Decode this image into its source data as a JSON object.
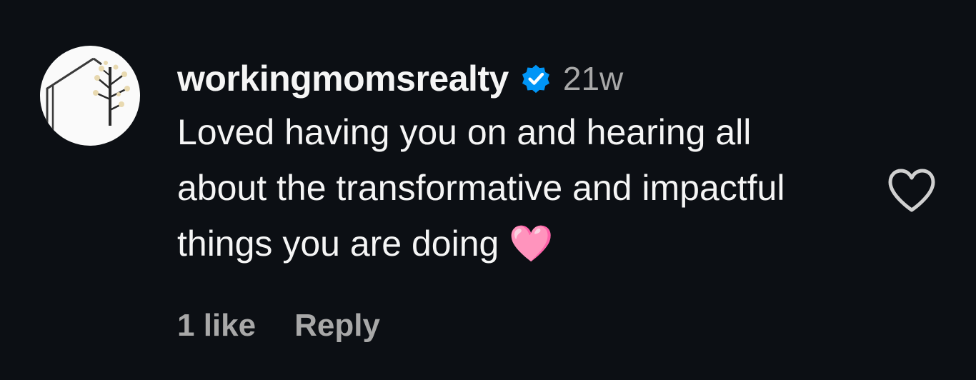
{
  "comment": {
    "username": "workingmomsrealty",
    "timestamp": "21w",
    "text": "Loved having you on and hearing all about the transformative and impactful things you are doing 🩷",
    "likes_label": "1 like",
    "reply_label": "Reply",
    "verified_icon": "verified-badge-icon",
    "like_icon": "heart-outline-icon",
    "avatar_icon": "house-tree-logo"
  },
  "colors": {
    "background": "#0c0f14",
    "primary_text": "#f5f5f5",
    "secondary_text": "#a8a8a8",
    "verified_blue": "#0095f6"
  }
}
